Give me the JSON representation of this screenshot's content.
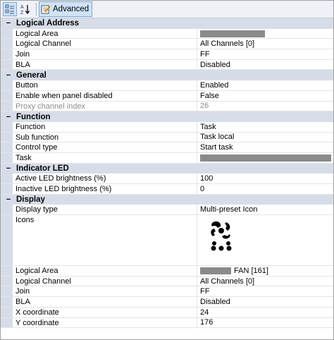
{
  "toolbar": {
    "categorized_icon": "categorized-icon",
    "alpha_icon": "alphabetical-sort-icon",
    "advanced_label": "Advanced",
    "advanced_icon": "notepad-edit-icon"
  },
  "sections": {
    "logical_address": {
      "title": "Logical Address",
      "toggle": "−",
      "rows": [
        {
          "name": "Logical Area",
          "value": ""
        },
        {
          "name": "Logical Channel",
          "value": "All Channels [0]"
        },
        {
          "name": "Join",
          "value": "FF"
        },
        {
          "name": "BLA",
          "value": "Disabled"
        }
      ]
    },
    "general": {
      "title": "General",
      "toggle": "−",
      "rows": [
        {
          "name": "Button",
          "value": "Enabled"
        },
        {
          "name": "Enable when panel disabled",
          "value": "False"
        },
        {
          "name": "Proxy channel index",
          "value": "26"
        }
      ]
    },
    "function": {
      "title": "Function",
      "toggle": "−",
      "rows": [
        {
          "name": "Function",
          "value": "Task"
        },
        {
          "name": "Sub function",
          "value": "Task local"
        },
        {
          "name": "Control type",
          "value": "Start task"
        },
        {
          "name": "Task",
          "value": ""
        }
      ]
    },
    "indicator_led": {
      "title": "Indicator LED",
      "toggle": "−",
      "rows": [
        {
          "name": "Active LED brightness (%)",
          "value": "100"
        },
        {
          "name": "Inactive LED brightness (%)",
          "value": "0"
        }
      ]
    },
    "display": {
      "title": "Display",
      "toggle": "−",
      "rows": [
        {
          "name": "Display type",
          "value": "Multi-preset Icon"
        },
        {
          "name": "Icons",
          "value": "",
          "icon": "fan-icon"
        },
        {
          "name": "Logical Area",
          "value": "FAN [161]"
        },
        {
          "name": "Logical Channel",
          "value": "All Channels [0]"
        },
        {
          "name": "Join",
          "value": "FF"
        },
        {
          "name": "BLA",
          "value": "Disabled"
        },
        {
          "name": "X coordinate",
          "value": "24"
        },
        {
          "name": "Y coordinate",
          "value": "176"
        }
      ]
    }
  }
}
